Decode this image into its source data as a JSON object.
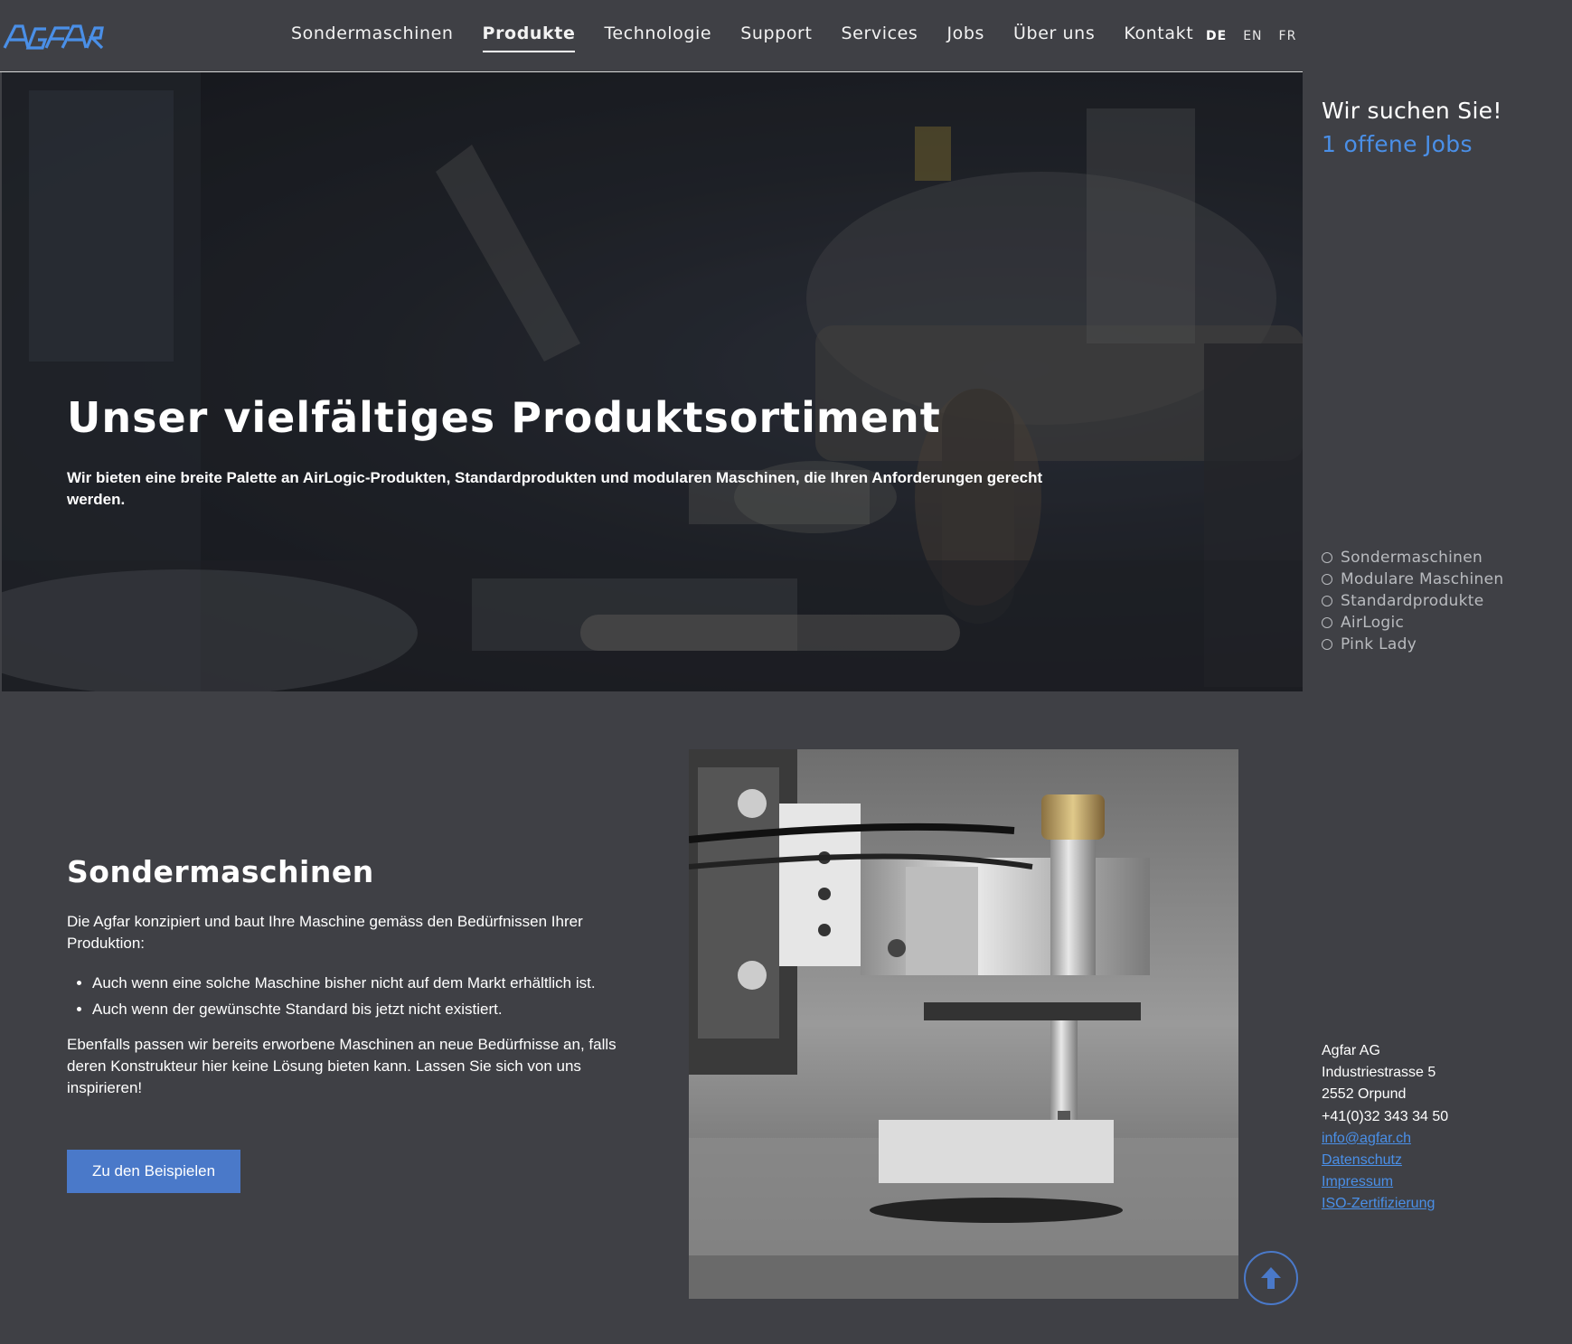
{
  "brand": {
    "logo_text": "AGFAR",
    "accent": "#4a8fe7",
    "button_color": "#4a79c9",
    "background": "#3f4045"
  },
  "nav": {
    "items": [
      {
        "label": "Sondermaschinen",
        "active": false
      },
      {
        "label": "Produkte",
        "active": true
      },
      {
        "label": "Technologie",
        "active": false
      },
      {
        "label": "Support",
        "active": false
      },
      {
        "label": "Services",
        "active": false
      },
      {
        "label": "Jobs",
        "active": false
      },
      {
        "label": "Über uns",
        "active": false
      },
      {
        "label": "Kontakt",
        "active": false
      }
    ],
    "languages": [
      {
        "label": "DE",
        "active": true
      },
      {
        "label": "EN",
        "active": false
      },
      {
        "label": "FR",
        "active": false
      }
    ]
  },
  "hero": {
    "title": "Unser vielfältiges Produktsortiment",
    "subtitle": "Wir bieten eine breite Palette an AirLogic-Produkten, Standardprodukten und modularen Maschinen, die Ihren Anforderungen gerecht werden."
  },
  "sidebar": {
    "jobs_heading": "Wir suchen Sie!",
    "jobs_link": "1 offene Jobs",
    "sections": [
      "Sondermaschinen",
      "Modulare Maschinen",
      "Standardprodukte",
      "AirLogic",
      "Pink Lady"
    ],
    "address": {
      "company": "Agfar AG",
      "street": "Industriestrasse 5",
      "city": "2552 Orpund",
      "phone": "+41(0)32 343 34 50",
      "email": "info@agfar.ch",
      "links": [
        "Datenschutz",
        "Impressum",
        "ISO-Zertifizierung"
      ]
    }
  },
  "section": {
    "title": "Sondermaschinen",
    "intro": "Die Agfar konzipiert und baut Ihre Maschine gemäss den Bedürfnissen Ihrer Produktion:",
    "bullets": [
      "Auch wenn eine solche Maschine bisher nicht auf dem Markt erhältlich ist.",
      "Auch wenn der gewünschte Standard bis jetzt nicht existiert."
    ],
    "outro": "Ebenfalls passen wir bereits erworbene Maschinen an neue Bedürfnisse an, falls deren Konstrukteur hier keine Lösung bieten kann. Lassen Sie sich von uns inspirieren!",
    "button": "Zu den Beispielen"
  }
}
